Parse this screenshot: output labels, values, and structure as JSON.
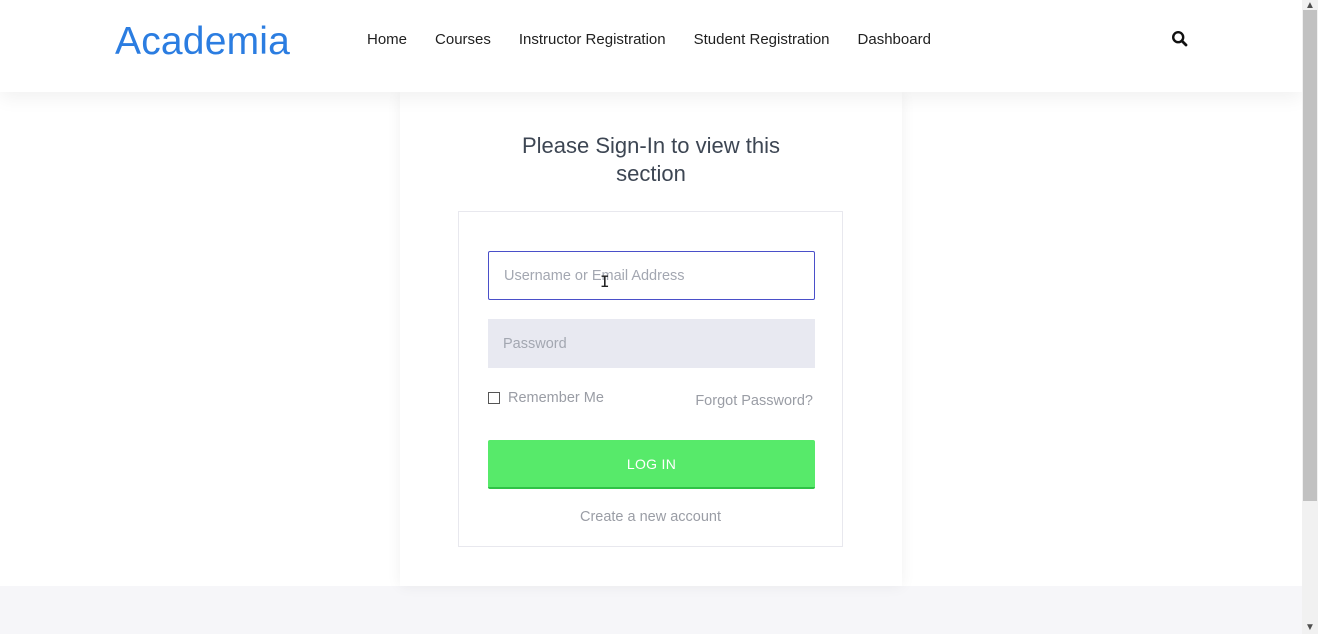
{
  "header": {
    "logo": "Academia",
    "nav": [
      "Home",
      "Courses",
      "Instructor Registration",
      "Student Registration",
      "Dashboard"
    ],
    "search_icon": "search-icon"
  },
  "login": {
    "title_line1": "Please Sign-In to view this",
    "title_line2": "section",
    "username_placeholder": "Username or Email Address",
    "password_placeholder": "Password",
    "remember_label": "Remember Me",
    "forgot_label": "Forgot Password?",
    "login_button": "LOG IN",
    "create_account": "Create a new account"
  },
  "colors": {
    "logo": "#2b7de1",
    "login_button": "#57ea6a",
    "input_focus_border": "#4a4fc9"
  }
}
